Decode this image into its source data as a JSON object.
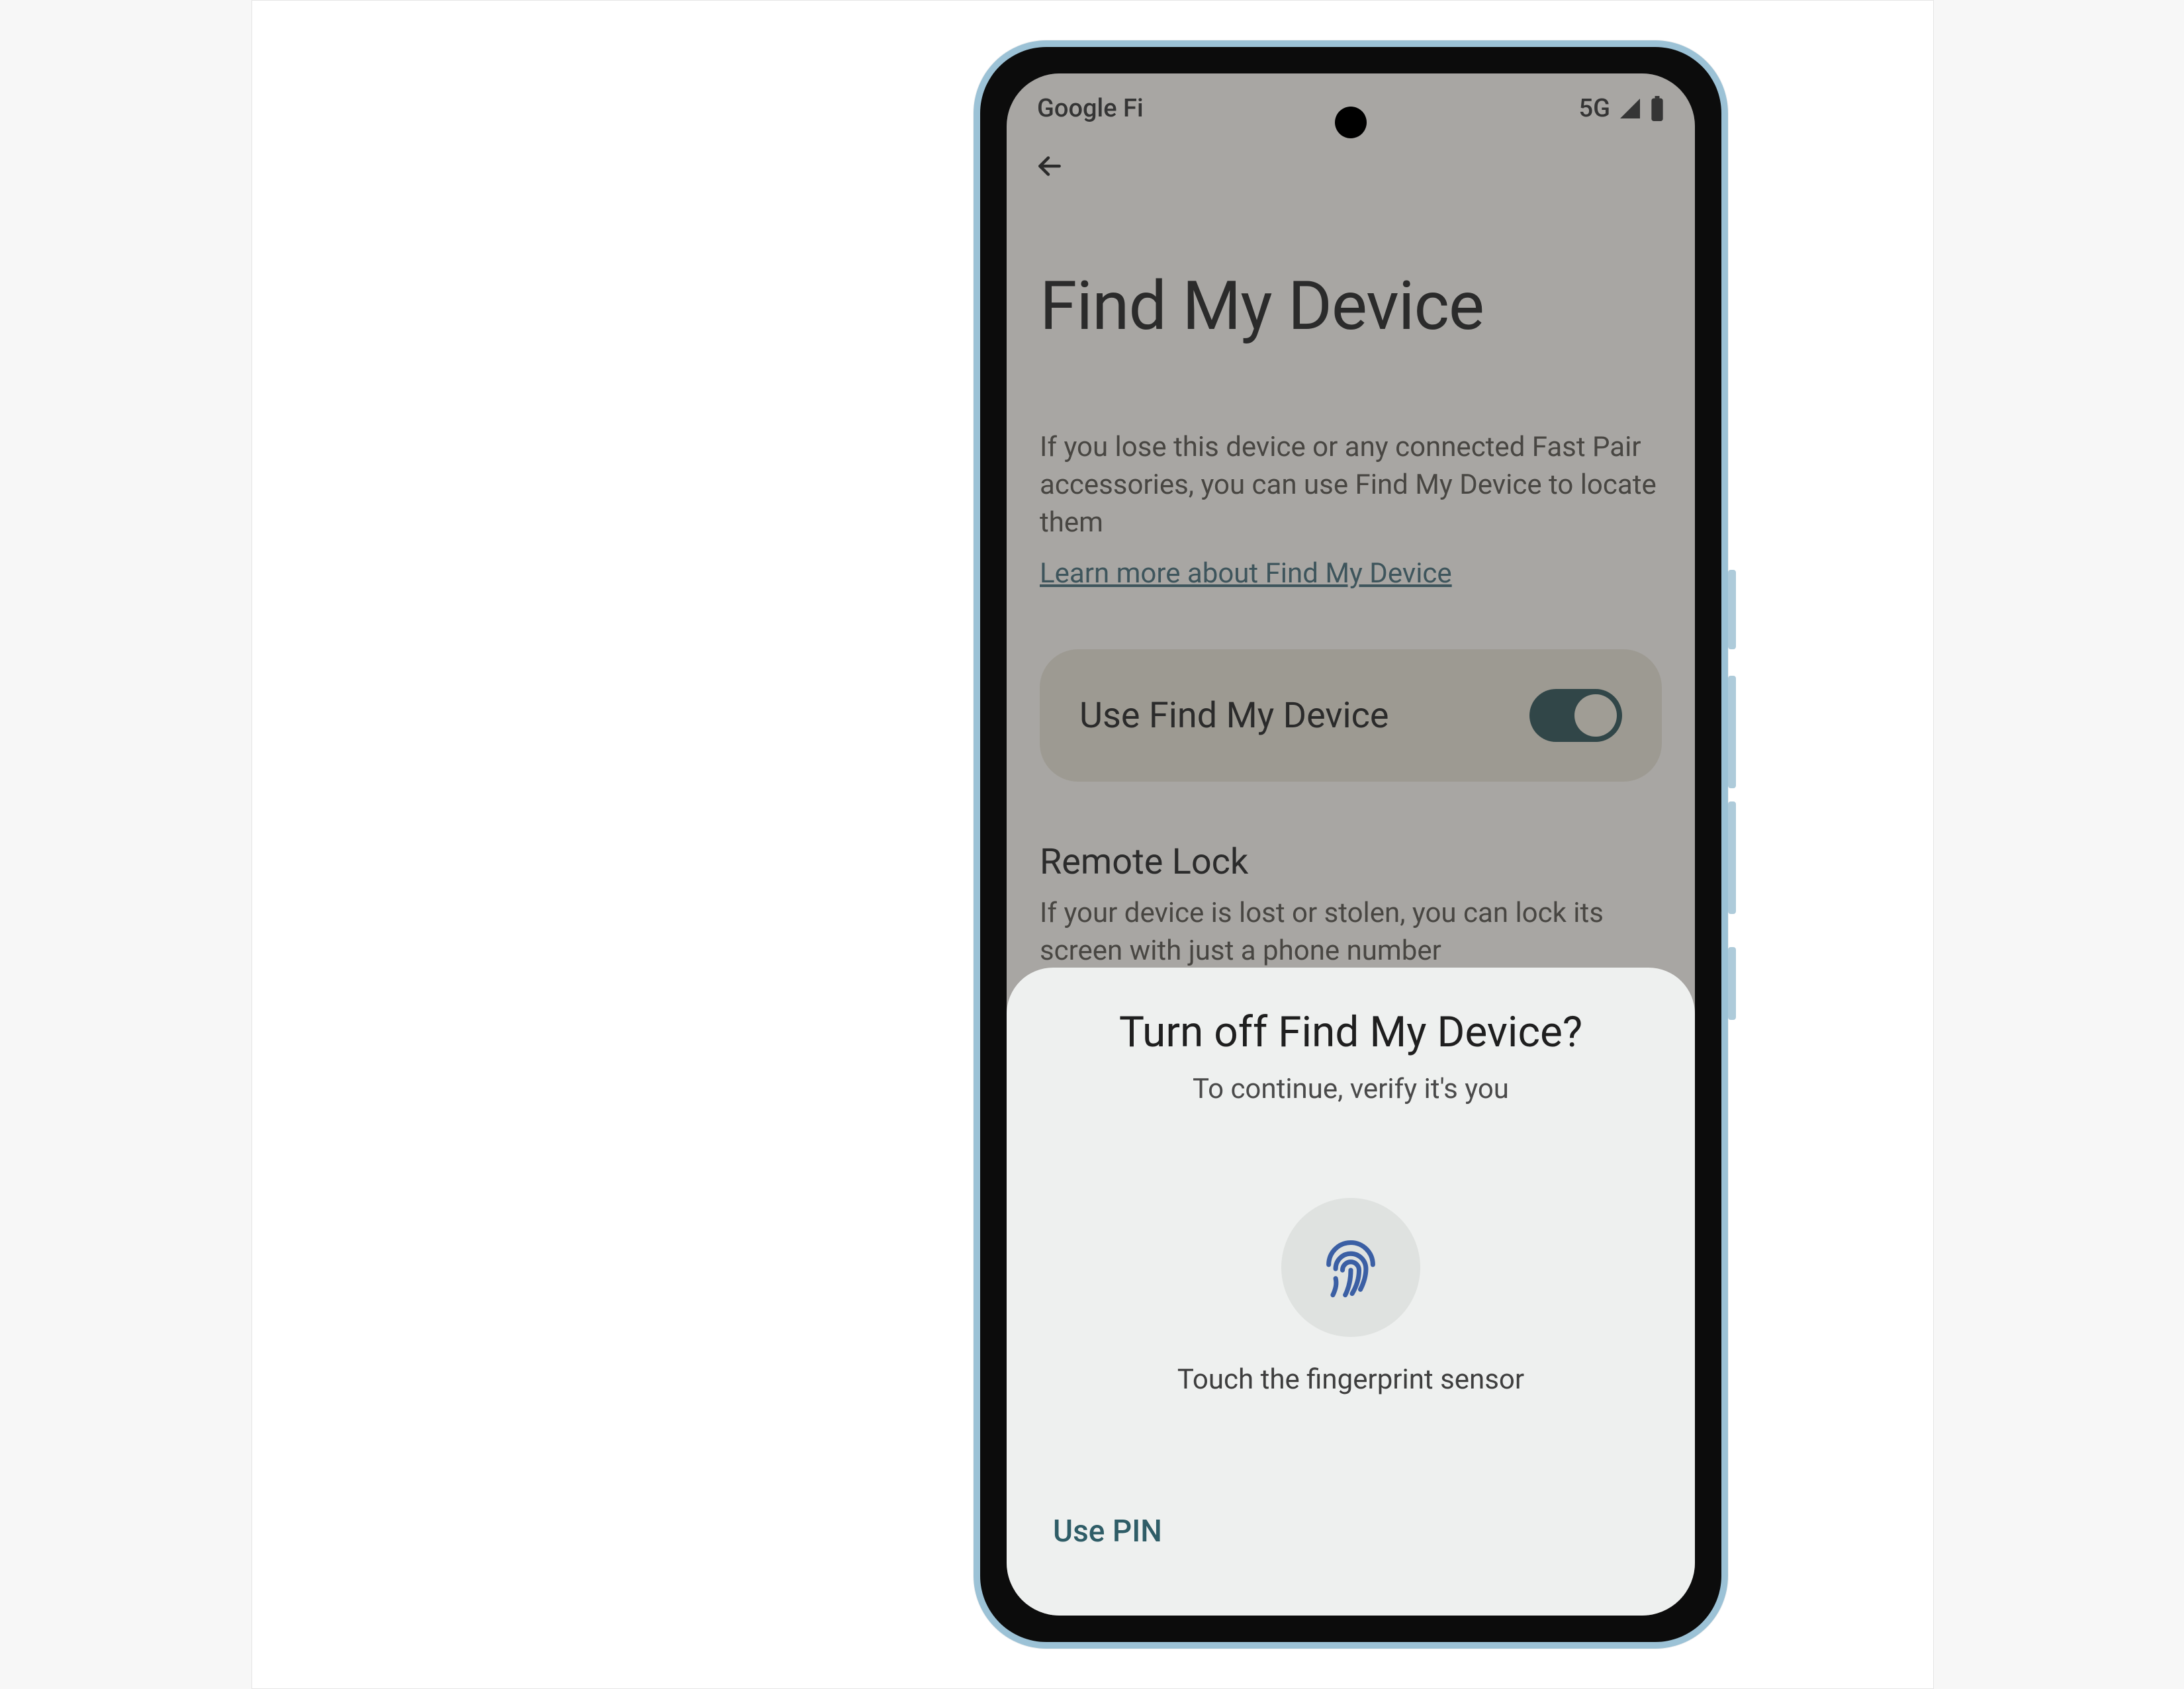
{
  "status_bar": {
    "carrier": "Google Fi",
    "network": "5G"
  },
  "page": {
    "title": "Find My Device",
    "description": "If you lose this device or any connected Fast Pair accessories, you can use Find My Device to locate them",
    "learn_more": "Learn more about Find My Device",
    "toggle": {
      "label": "Use Find My Device",
      "state": "on"
    },
    "remote_lock": {
      "title": "Remote Lock",
      "description": "If your device is lost or stolen, you can lock its screen with just a phone number"
    }
  },
  "sheet": {
    "title": "Turn off Find My Device?",
    "subtitle": "To continue, verify it's you",
    "fingerprint_hint": "Touch the fingerprint sensor",
    "alt_action": "Use PIN"
  }
}
